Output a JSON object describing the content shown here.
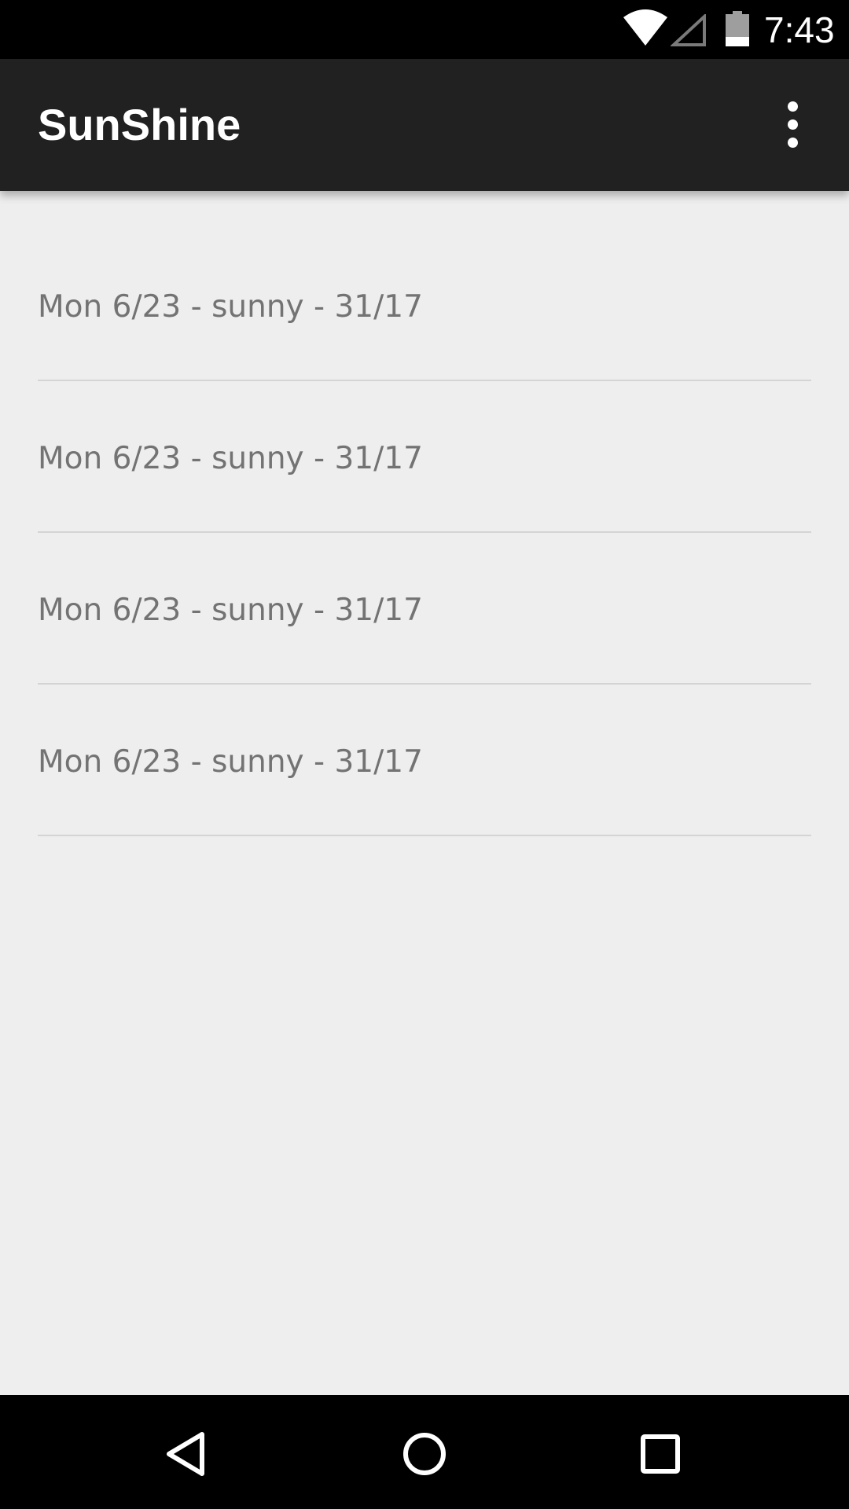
{
  "status_bar": {
    "time": "7:43",
    "icons": [
      "wifi-icon",
      "cell-signal-icon",
      "battery-icon"
    ]
  },
  "app_bar": {
    "title": "SunShine",
    "overflow_icon": "more-vert-icon"
  },
  "forecast": {
    "items": [
      {
        "label": "Mon 6/23 - sunny - 31/17"
      },
      {
        "label": "Mon 6/23 - sunny - 31/17"
      },
      {
        "label": "Mon 6/23 - sunny - 31/17"
      },
      {
        "label": "Mon 6/23 - sunny - 31/17"
      }
    ]
  },
  "nav_bar": {
    "buttons": [
      "back-icon",
      "home-icon",
      "recents-icon"
    ]
  },
  "colors": {
    "status_bar": "#000000",
    "app_bar": "#212121",
    "background": "#eeeeee",
    "item_text": "#737373",
    "divider": "#d4d4d4"
  }
}
